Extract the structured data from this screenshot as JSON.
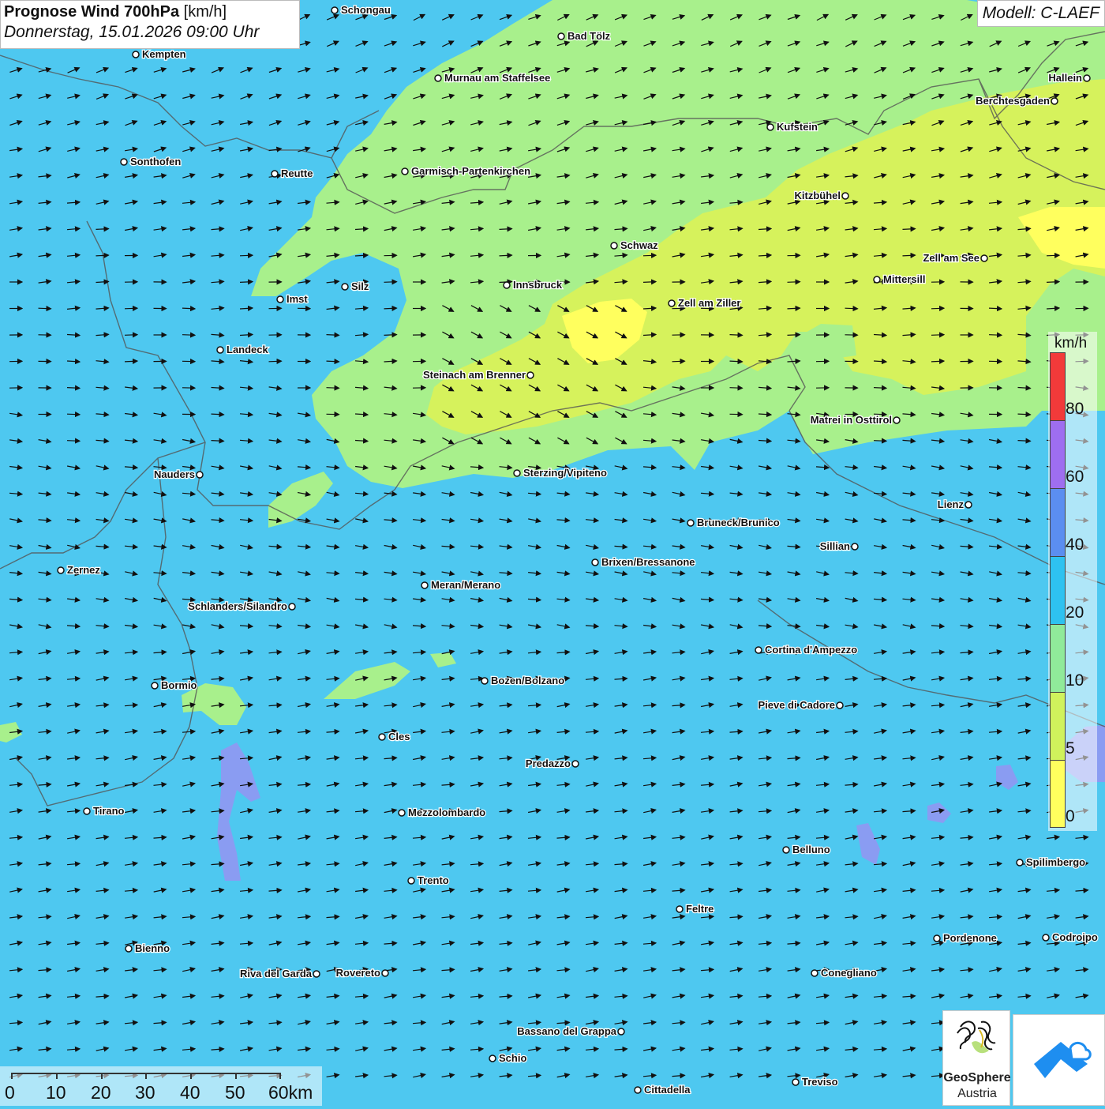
{
  "title": {
    "main": "Prognose Wind 700hPa",
    "unit": "[km/h]",
    "date": "Donnerstag, 15.01.2026 09:00 Uhr"
  },
  "model": "Modell: C-LAEF",
  "legend": {
    "title": "km/h",
    "labels": [
      "80",
      "60",
      "40",
      "20",
      "10",
      "5",
      "0"
    ],
    "colors": [
      "#f23a3a",
      "#9e6ef0",
      "#5b8ef0",
      "#2ec2f0",
      "#90ea9a",
      "#d0f25c",
      "#ffff5e"
    ]
  },
  "scalebar": {
    "labels": [
      "0",
      "10",
      "20",
      "30",
      "40",
      "50",
      "60km"
    ]
  },
  "logos": {
    "geosphere_line1": "GeoSphere",
    "geosphere_line2": "Austria"
  },
  "colors": {
    "calm_zone": "#a8f08c",
    "light_zone": "#d6f25c",
    "moderate_zone": "#4ec8f0",
    "stronger_zone": "#8a9cf2"
  },
  "cities": [
    {
      "name": "Schongau"
    },
    {
      "name": "Bad Tölz"
    },
    {
      "name": "Kempten"
    },
    {
      "name": "Murnau am Staffelsee"
    },
    {
      "name": "Hallein"
    },
    {
      "name": "Berchtesgaden"
    },
    {
      "name": "Kufstein"
    },
    {
      "name": "Sonthofen"
    },
    {
      "name": "Reutte"
    },
    {
      "name": "Garmisch-Partenkirchen"
    },
    {
      "name": "Kitzbühel"
    },
    {
      "name": "Schwaz"
    },
    {
      "name": "Zell am See"
    },
    {
      "name": "Mittersill"
    },
    {
      "name": "Innsbruck"
    },
    {
      "name": "Silz"
    },
    {
      "name": "Imst"
    },
    {
      "name": "Zell am Ziller"
    },
    {
      "name": "Landeck"
    },
    {
      "name": "Steinach am Brenner"
    },
    {
      "name": "Matrei in Osttirol"
    },
    {
      "name": "Nauders"
    },
    {
      "name": "Sterzing/Vipiteno"
    },
    {
      "name": "Lienz"
    },
    {
      "name": "Bruneck/Brunico"
    },
    {
      "name": "Sillian"
    },
    {
      "name": "Zernez"
    },
    {
      "name": "Brixen/Bressanone"
    },
    {
      "name": "Meran/Merano"
    },
    {
      "name": "Schlanders/Silandro"
    },
    {
      "name": "Cortina d'Ampezzo"
    },
    {
      "name": "Bozen/Bolzano"
    },
    {
      "name": "Bormio"
    },
    {
      "name": "Pieve di Cadore"
    },
    {
      "name": "Cles"
    },
    {
      "name": "Predazzo"
    },
    {
      "name": "Tirano"
    },
    {
      "name": "Mezzolombardo"
    },
    {
      "name": "Belluno"
    },
    {
      "name": "Spilimbergo"
    },
    {
      "name": "Trento"
    },
    {
      "name": "Feltre"
    },
    {
      "name": "Bienno"
    },
    {
      "name": "Pordenone"
    },
    {
      "name": "Codroipo"
    },
    {
      "name": "Riva del Garda"
    },
    {
      "name": "Rovereto"
    },
    {
      "name": "Conegliano"
    },
    {
      "name": "Bassano del Grappa"
    },
    {
      "name": "Schio"
    },
    {
      "name": "Treviso"
    },
    {
      "name": "Cittadella"
    }
  ]
}
